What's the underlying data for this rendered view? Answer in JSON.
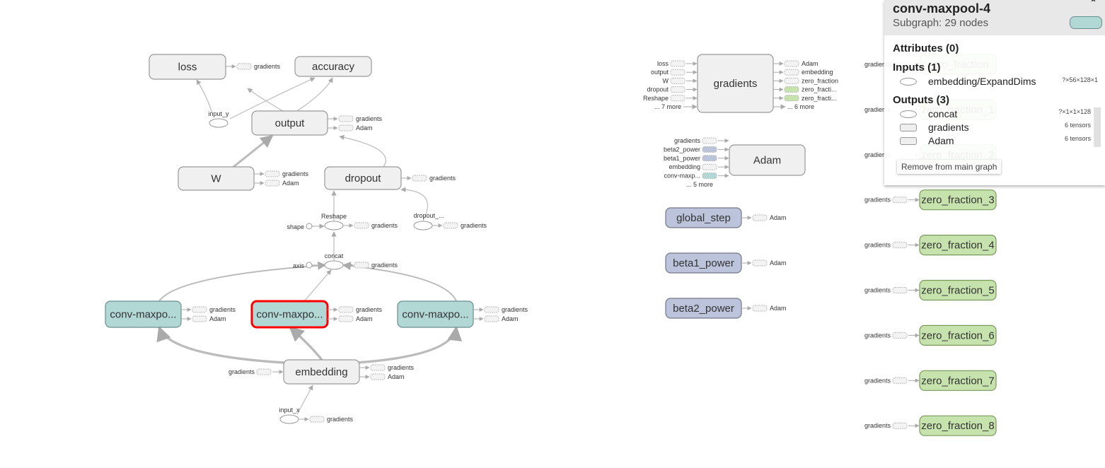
{
  "graph": {
    "main_nodes": [
      "loss",
      "accuracy",
      "output",
      "W",
      "dropout",
      "conv-maxpo...",
      "conv-maxpo...",
      "conv-maxpo...",
      "embedding"
    ],
    "op_nodes": [
      "input_y",
      "Reshape",
      "shape",
      "dropout_...",
      "concat",
      "axis",
      "input_x"
    ],
    "aux_nodes": [
      "gradients",
      "Adam",
      "global_step",
      "beta1_power",
      "beta2_power"
    ],
    "zero_fractions": [
      "zero_fraction",
      "zero_fraction_1",
      "zero_fraction_2",
      "zero_fraction_3",
      "zero_fraction_4",
      "zero_fraction_5",
      "zero_fraction_6",
      "zero_fraction_7",
      "zero_fraction_8"
    ],
    "stub_labels": {
      "gradients": "gradients",
      "adam": "Adam"
    },
    "gradients_inputs": [
      "loss",
      "output",
      "W",
      "dropout",
      "Reshape",
      "... 7 more"
    ],
    "gradients_outputs": [
      "Adam",
      "embedding",
      "zero_fraction",
      "zero_fracti...",
      "zero_fracti...",
      "... 6 more"
    ],
    "adam_inputs": [
      "gradients",
      "beta2_power",
      "beta1_power",
      "embedding",
      "conv-maxp...",
      "... 5 more"
    ],
    "selected_node_index": 6,
    "colors": {
      "node_fill": "#f0f0f0",
      "conv_fill": "#b2d8d6",
      "var_fill": "#bcc4db",
      "zero_fill": "#c7e3ad",
      "selected": "#ff0000"
    }
  },
  "panel": {
    "title": "conv-maxpool-4",
    "subtitle": "Subgraph: 29 nodes",
    "attributes_heading": "Attributes (0)",
    "inputs_heading": "Inputs (1)",
    "inputs": [
      {
        "name": "embedding/ExpandDims",
        "shape": "?×56×128×1",
        "icon": "op-ellipse"
      }
    ],
    "outputs_heading": "Outputs (3)",
    "outputs": [
      {
        "name": "concat",
        "shape": "?×1×1×128",
        "icon": "op-ellipse"
      },
      {
        "name": "gradients",
        "shape": "6 tensors",
        "icon": "metanode-rect"
      },
      {
        "name": "Adam",
        "shape": "6 tensors",
        "icon": "metanode-rect"
      }
    ],
    "remove_button": "Remove from main graph",
    "collapse_icon": "chevron-up-icon"
  }
}
